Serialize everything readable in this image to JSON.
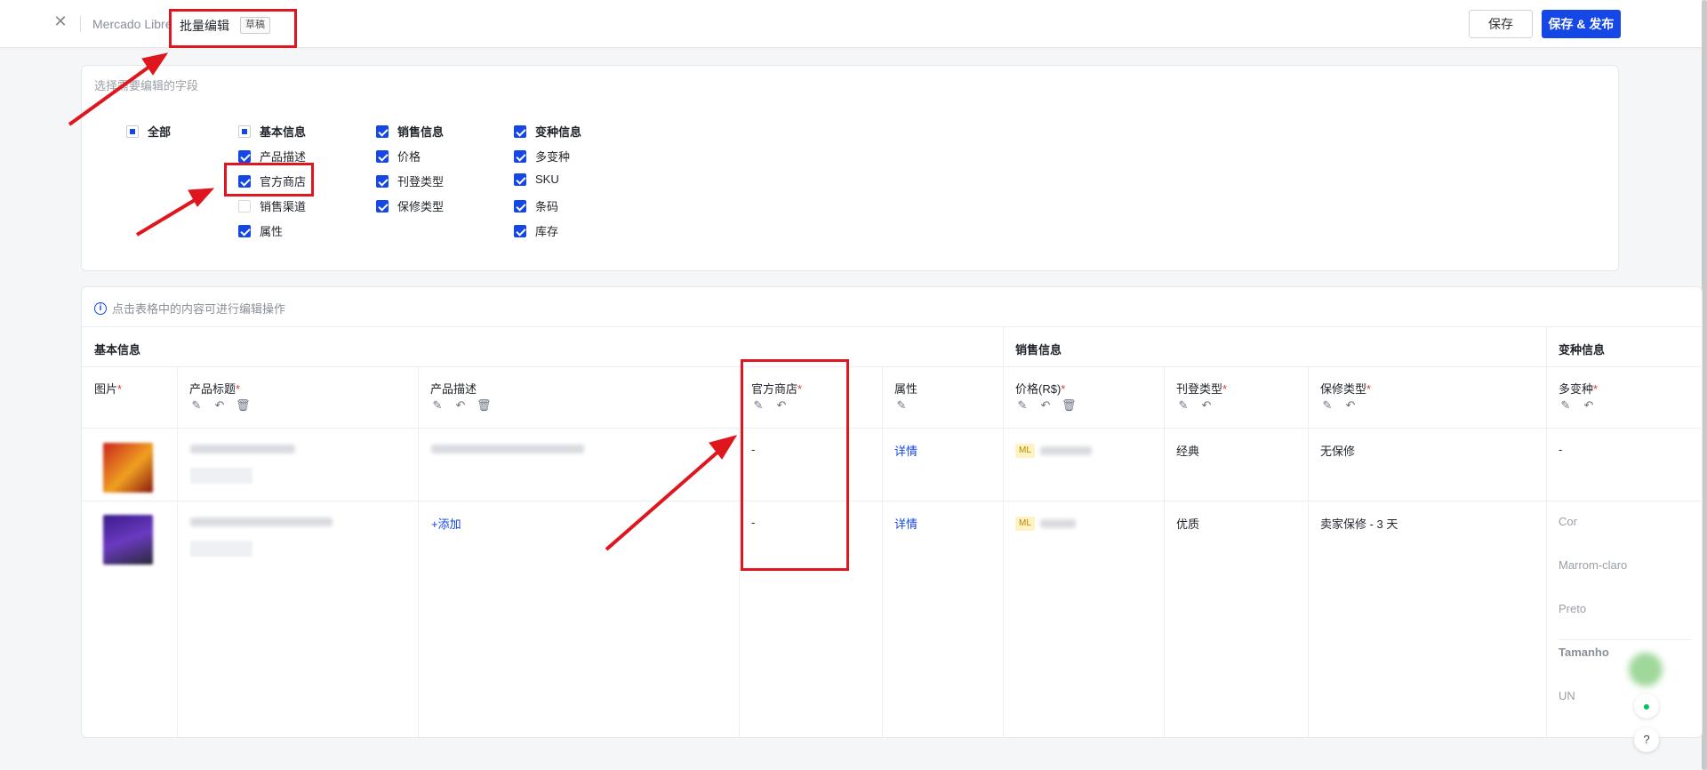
{
  "header": {
    "store_name": "Mercado Libre",
    "separator": "/",
    "page_title": "批量编辑",
    "status_badge": "草稿",
    "save_label": "保存",
    "publish_label": "保存 & 发布"
  },
  "field_selector": {
    "hint": "选择需要编辑的字段",
    "all": {
      "label": "全部",
      "state": "indeterminate"
    },
    "groups": [
      {
        "label": "基本信息",
        "state": "indeterminate",
        "items": [
          {
            "label": "产品描述",
            "checked": true
          },
          {
            "label": "官方商店",
            "checked": true
          },
          {
            "label": "销售渠道",
            "checked": false
          },
          {
            "label": "属性",
            "checked": true
          }
        ]
      },
      {
        "label": "销售信息",
        "state": "checked",
        "items": [
          {
            "label": "价格",
            "checked": true
          },
          {
            "label": "刊登类型",
            "checked": true
          },
          {
            "label": "保修类型",
            "checked": true
          }
        ]
      },
      {
        "label": "变种信息",
        "state": "checked",
        "items": [
          {
            "label": "多变种",
            "checked": true
          },
          {
            "label": "SKU",
            "checked": true
          },
          {
            "label": "条码",
            "checked": true
          },
          {
            "label": "库存",
            "checked": true
          }
        ]
      }
    ]
  },
  "table": {
    "hint": "点击表格中的内容可进行编辑操作",
    "groups": {
      "basic": "基本信息",
      "sales": "销售信息",
      "variant": "变种信息"
    },
    "columns": {
      "image": "图片",
      "title": "产品标题",
      "description": "产品描述",
      "official_store": "官方商店",
      "attributes": "属性",
      "price": "价格(R$)",
      "listing_type": "刊登类型",
      "warranty": "保修类型",
      "variants": "多变种"
    },
    "required_mark": "*",
    "rows": [
      {
        "description": "",
        "official_store": "-",
        "attributes": "详情",
        "price_badge": "ML",
        "listing_type": "经典",
        "warranty": "无保修",
        "variants": "-"
      },
      {
        "description": "+添加",
        "official_store": "-",
        "attributes": "详情",
        "price_badge": "ML",
        "listing_type": "优质",
        "warranty": "卖家保修 - 3 天",
        "variants": [
          "Cor",
          "Marrom-claro",
          "Preto",
          "Tamanho",
          "UN"
        ]
      }
    ]
  },
  "colors": {
    "primary": "#1447e6",
    "annotation": "#e0161f",
    "required": "#e53935"
  }
}
